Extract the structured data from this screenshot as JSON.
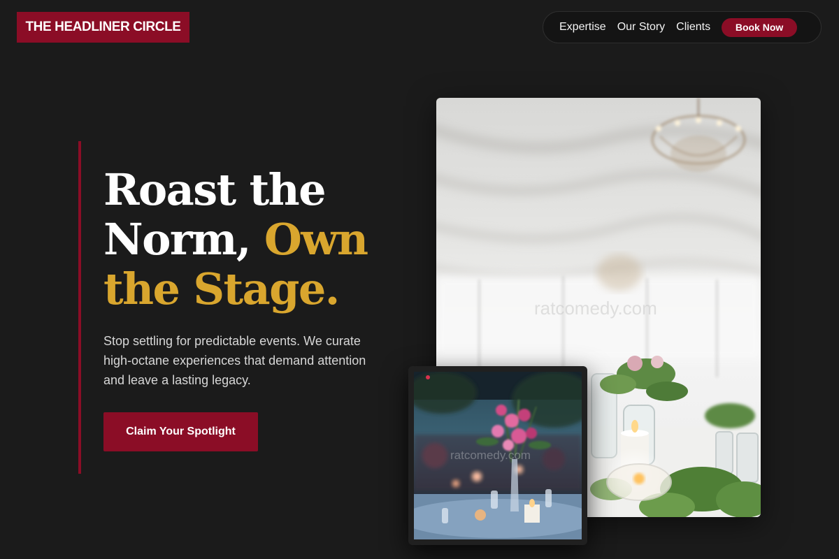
{
  "header": {
    "logo_text": "THE HEADLINER CIRCLE",
    "nav": [
      {
        "label": "Expertise"
      },
      {
        "label": "Our Story"
      },
      {
        "label": "Clients"
      }
    ],
    "cta_label": "Book Now"
  },
  "hero": {
    "headline_line1": "Roast the",
    "headline_line2_white": "Norm, ",
    "headline_line2_gold": "Own",
    "headline_line3_gold": "the Stage.",
    "subtext": "Stop settling for predictable events. We curate high-octane experiences that demand attention and leave a lasting legacy.",
    "cta_label": "Claim Your Spotlight"
  },
  "images": {
    "main_watermark": "ratcomedy.com",
    "small_watermark": "ratcomedy.com"
  },
  "colors": {
    "background": "#1b1b1b",
    "brand_red": "#8b0d26",
    "gold": "#d9a62e"
  }
}
